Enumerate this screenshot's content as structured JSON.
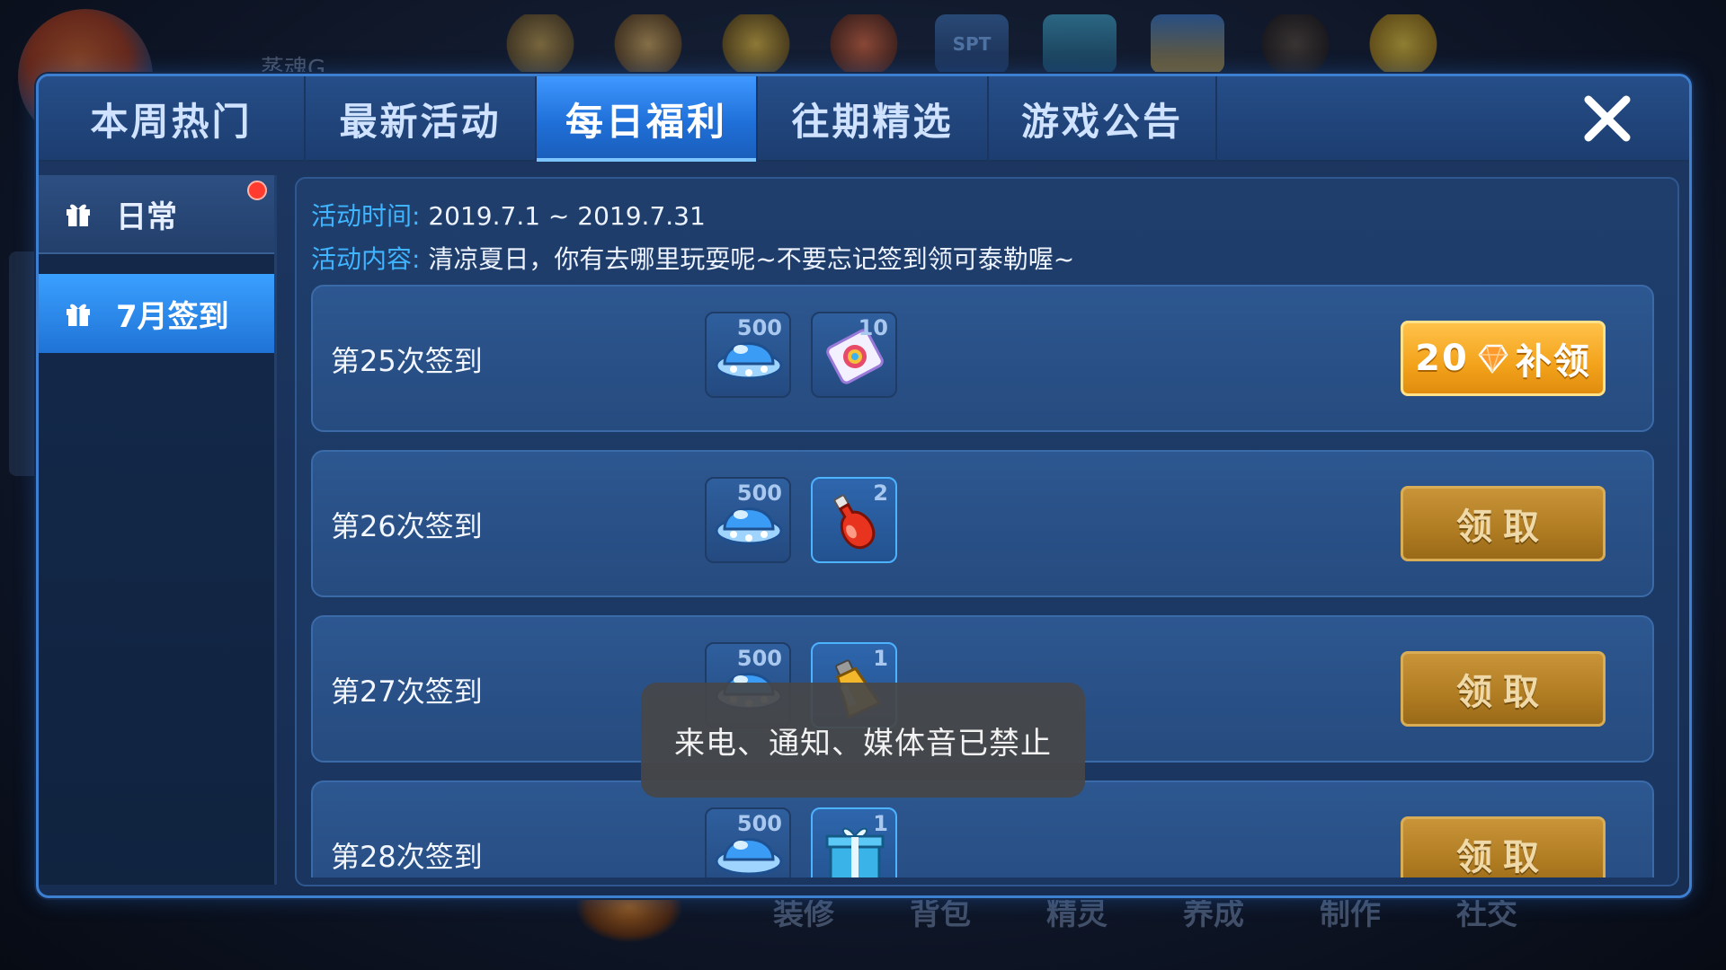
{
  "background": {
    "player_name": "蒸魂G",
    "bottom_nav": [
      "装修",
      "背包",
      "精灵",
      "养成",
      "制作",
      "社交"
    ],
    "spt_icon_text": "SPT"
  },
  "tabs": [
    {
      "label": "本周热门"
    },
    {
      "label": "最新活动"
    },
    {
      "label": "每日福利",
      "active": true
    },
    {
      "label": "往期精选"
    },
    {
      "label": "游戏公告"
    }
  ],
  "sidebar": {
    "items": [
      {
        "label": "日常",
        "has_notification": true
      },
      {
        "label": "7月签到",
        "active": true
      }
    ]
  },
  "activity": {
    "time_label": "活动时间:",
    "time_value": "2019.7.1 ~ 2019.7.31",
    "content_label": "活动内容:",
    "content_value": "清凉夏日，你有去哪里玩耍呢~不要忘记签到领可泰勒喔~"
  },
  "rows": [
    {
      "label": "第25次签到",
      "items": [
        {
          "icon": "ufo-coin-icon",
          "qty": "500"
        },
        {
          "icon": "card-ticket-icon",
          "qty": "10"
        }
      ],
      "button": {
        "type": "makeup",
        "cost": "20",
        "label": "补领"
      }
    },
    {
      "label": "第26次签到",
      "items": [
        {
          "icon": "ufo-coin-icon",
          "qty": "500"
        },
        {
          "icon": "red-potion-icon",
          "qty": "2"
        }
      ],
      "button": {
        "type": "claim",
        "label": "领取"
      }
    },
    {
      "label": "第27次签到",
      "items": [
        {
          "icon": "ufo-coin-icon",
          "qty": "500"
        },
        {
          "icon": "gold-potion-icon",
          "qty": "1"
        }
      ],
      "button": {
        "type": "claim",
        "label": "领取"
      }
    },
    {
      "label": "第28次签到",
      "items": [
        {
          "icon": "ufo-coin-icon",
          "qty": "500"
        },
        {
          "icon": "gift-box-icon",
          "qty": "1"
        }
      ],
      "button": {
        "type": "claim",
        "label": "领取"
      }
    }
  ],
  "toast": {
    "message": "来电、通知、媒体音已禁止"
  },
  "colors": {
    "accent_blue": "#3f98ff",
    "label_blue": "#3fb4ff",
    "makeup_orange": "#f3a21b",
    "claim_gold": "#b07c22",
    "notification_red": "#ff3b2f"
  }
}
